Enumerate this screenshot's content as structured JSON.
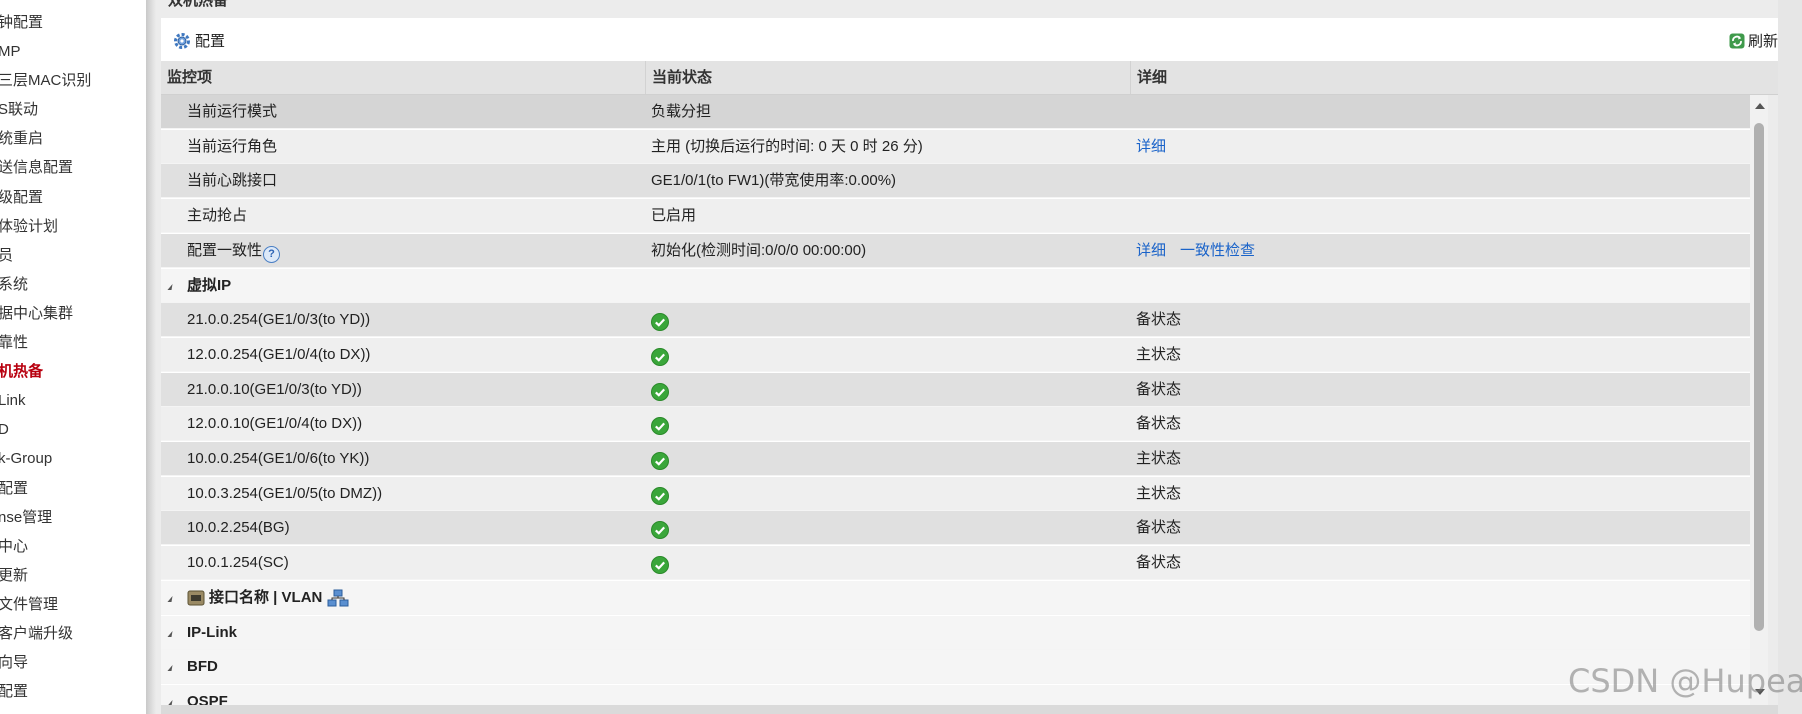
{
  "sidebar": {
    "items": [
      {
        "label": "钟配置",
        "active": false
      },
      {
        "label": "MP",
        "active": false
      },
      {
        "label": "三层MAC识别",
        "active": false
      },
      {
        "label": "S联动",
        "active": false
      },
      {
        "label": "统重启",
        "active": false
      },
      {
        "label": "送信息配置",
        "active": false
      },
      {
        "label": "级配置",
        "active": false
      },
      {
        "label": "体验计划",
        "active": false
      },
      {
        "label": "员",
        "active": false
      },
      {
        "label": "系统",
        "active": false
      },
      {
        "label": "据中心集群",
        "active": false
      },
      {
        "label": "靠性",
        "active": false
      },
      {
        "label": "机热备",
        "active": true
      },
      {
        "label": "Link",
        "active": false
      },
      {
        "label": "D",
        "active": false
      },
      {
        "label": "k-Group",
        "active": false
      },
      {
        "label": "配置",
        "active": false
      },
      {
        "label": "nse管理",
        "active": false
      },
      {
        "label": "中心",
        "active": false
      },
      {
        "label": "更新",
        "active": false
      },
      {
        "label": "文件管理",
        "active": false
      },
      {
        "label": "客户端升级",
        "active": false
      },
      {
        "label": "向导",
        "active": false
      },
      {
        "label": "配置",
        "active": false
      }
    ]
  },
  "panel": {
    "title": "双机热备",
    "toolbar": {
      "config_label": "配置",
      "refresh_label": "刷新"
    },
    "columns": {
      "item": "监控项",
      "status": "当前状态",
      "detail": "详细"
    },
    "rows": [
      {
        "item": "当前运行模式",
        "status": "负载分担",
        "links": []
      },
      {
        "item": "当前运行角色",
        "status": "主用 (切换后运行的时间: 0 天 0 时 26 分)",
        "links": [
          "详细"
        ]
      },
      {
        "item": "当前心跳接口",
        "status": "GE1/0/1(to FW1)(带宽使用率:0.00%)",
        "links": []
      },
      {
        "item": "主动抢占",
        "status": "已启用",
        "links": []
      },
      {
        "item": "配置一致性",
        "status": "初始化(检测时间:0/0/0 00:00:00)",
        "links": [
          "详细",
          "一致性检查"
        ],
        "help": "?"
      }
    ],
    "vip_group": {
      "label": "虚拟IP",
      "rows": [
        {
          "ip": "21.0.0.254(GE1/0/3(to YD))",
          "state": "备状态"
        },
        {
          "ip": "12.0.0.254(GE1/0/4(to DX))",
          "state": "主状态"
        },
        {
          "ip": "21.0.0.10(GE1/0/3(to YD))",
          "state": "备状态"
        },
        {
          "ip": "12.0.0.10(GE1/0/4(to DX))",
          "state": "备状态"
        },
        {
          "ip": "10.0.0.254(GE1/0/6(to YK))",
          "state": "主状态"
        },
        {
          "ip": "10.0.3.254(GE1/0/5(to DMZ))",
          "state": "主状态"
        },
        {
          "ip": "10.0.2.254(BG)",
          "state": "备状态"
        },
        {
          "ip": "10.0.1.254(SC)",
          "state": "备状态"
        }
      ]
    },
    "other_groups": {
      "iface": "接口名称 | VLAN",
      "iplink": "IP-Link",
      "bfd": "BFD",
      "ospf": "OSPF"
    }
  },
  "watermark": "CSDN @Hupea",
  "colors": {
    "link": "#1a63c9",
    "active_nav": "#b8000f",
    "ok_green": "#3aa63a"
  }
}
